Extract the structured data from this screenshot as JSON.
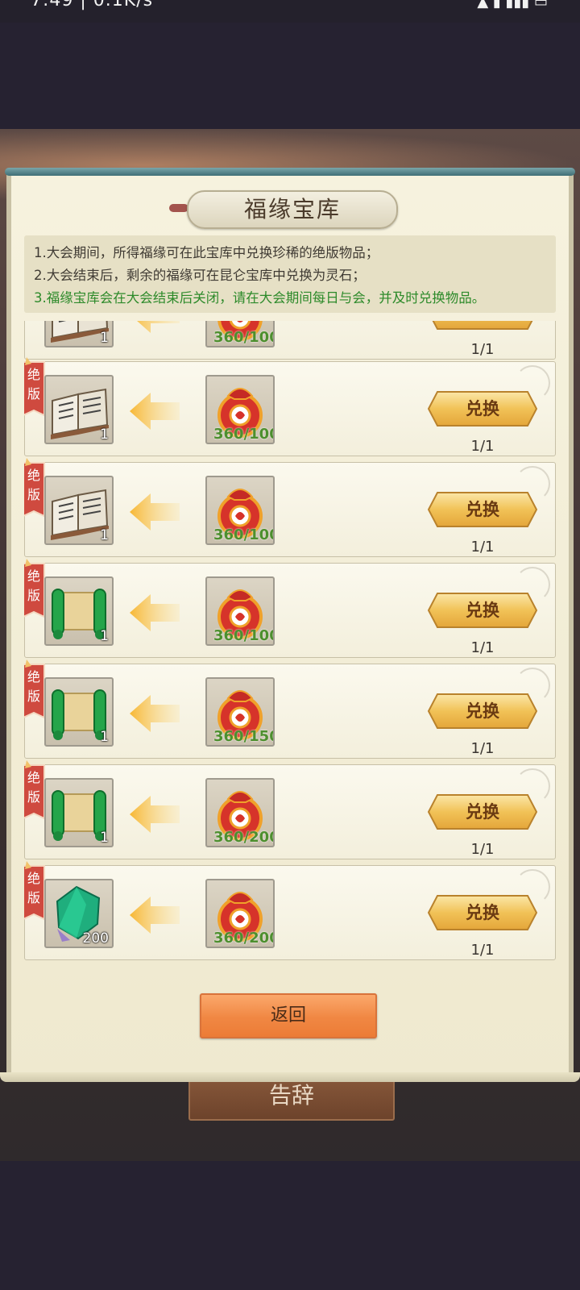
{
  "status_bar": {
    "left_text": "7:49 | 0.1K/s",
    "right_text": ""
  },
  "title": "福缘宝库",
  "rules": [
    "1.大会期间，所得福缘可在此宝库中兑换珍稀的绝版物品；",
    "2.大会结束后，剩余的福缘可在昆仑宝库中兑换为灵石；",
    "3.福缘宝库会在大会结束后关闭，请在大会期间每日与会，并及时兑换物品。"
  ],
  "badge_label": "绝版",
  "rows": [
    {
      "item": "book",
      "item_qty": "1",
      "cost": "360/100",
      "button": "",
      "limit": "1/1"
    },
    {
      "item": "book",
      "item_qty": "1",
      "cost": "360/100",
      "button": "兑换",
      "limit": "1/1"
    },
    {
      "item": "book",
      "item_qty": "1",
      "cost": "360/100",
      "button": "兑换",
      "limit": "1/1"
    },
    {
      "item": "scroll",
      "item_qty": "1",
      "cost": "360/100",
      "button": "兑换",
      "limit": "1/1"
    },
    {
      "item": "scroll",
      "item_qty": "1",
      "cost": "360/150",
      "button": "兑换",
      "limit": "1/1"
    },
    {
      "item": "scroll",
      "item_qty": "1",
      "cost": "360/200",
      "button": "兑换",
      "limit": "1/1"
    },
    {
      "item": "gem",
      "item_qty": "200",
      "cost": "360/200",
      "button": "兑换",
      "limit": "1/1"
    }
  ],
  "back_button": "返回",
  "background_button": "告辞",
  "colors": {
    "accent_green": "#2d8a2a",
    "button_gold": "#f3c45a",
    "back_orange": "#f08743"
  }
}
